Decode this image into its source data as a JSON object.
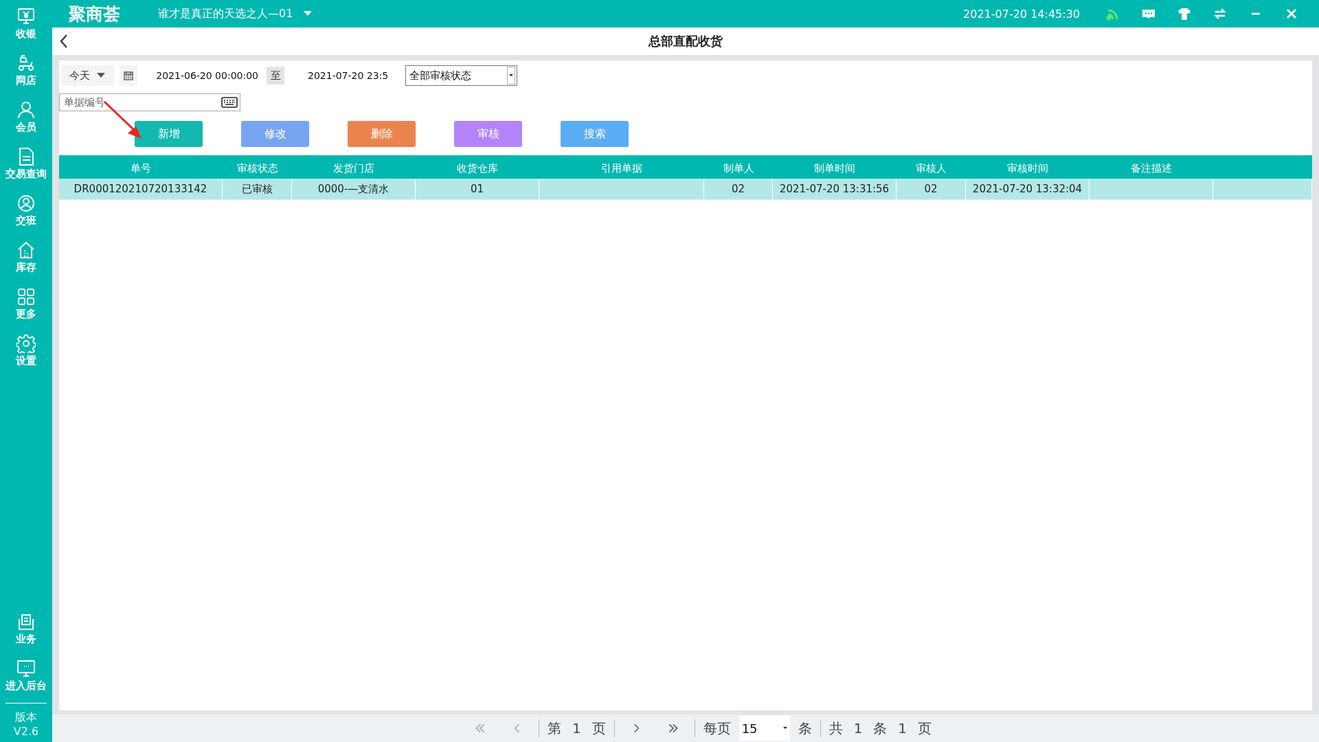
{
  "sidebar": {
    "items": [
      {
        "label": "收银"
      },
      {
        "label": "网店"
      },
      {
        "label": "会员"
      },
      {
        "label": "交易查询"
      },
      {
        "label": "交班"
      },
      {
        "label": "库存"
      },
      {
        "label": "更多"
      },
      {
        "label": "设置"
      }
    ],
    "bottom_items": [
      {
        "label": "业务"
      },
      {
        "label": "进入后台"
      }
    ],
    "version_label": "版本",
    "version": "V2.6"
  },
  "header": {
    "logo": "聚商荟",
    "store": "谁才是真正的天选之人—01",
    "datetime": "2021-07-20 14:45:30"
  },
  "page_title": "总部直配收货",
  "filters": {
    "period": "今天",
    "start": "2021-06-20 00:00:00",
    "separator": "至",
    "end": "2021-07-20 23:5",
    "status": "全部审核状态",
    "order_no": {
      "placeholder": "单据编号"
    }
  },
  "buttons": [
    {
      "label": "新增",
      "color": "#13b8ae"
    },
    {
      "label": "修改",
      "color": "#77a4f0"
    },
    {
      "label": "删除",
      "color": "#ea844f"
    },
    {
      "label": "审核",
      "color": "#b283f9"
    },
    {
      "label": "搜索",
      "color": "#5aacf5"
    }
  ],
  "table": {
    "columns": [
      "单号",
      "审核状态",
      "发货门店",
      "收货仓库",
      "引用单据",
      "制单人",
      "制单时间",
      "审核人",
      "审核时间",
      "备注描述"
    ],
    "rows": [
      {
        "selected": true,
        "cells": [
          "DR000120210720133142",
          "已审核",
          "0000-—支清水",
          "01",
          "",
          "02",
          "2021-07-20 13:31:56",
          "02",
          "2021-07-20 13:32:04",
          ""
        ]
      }
    ]
  },
  "pagination": {
    "page_prefix": "第",
    "page": "1",
    "page_suffix": "页",
    "per_page_label": "每页",
    "per_page": "15",
    "per_page_unit": "条",
    "total_prefix": "共",
    "total": "1",
    "total_unit": "条",
    "pages": "1",
    "pages_unit": "页"
  }
}
